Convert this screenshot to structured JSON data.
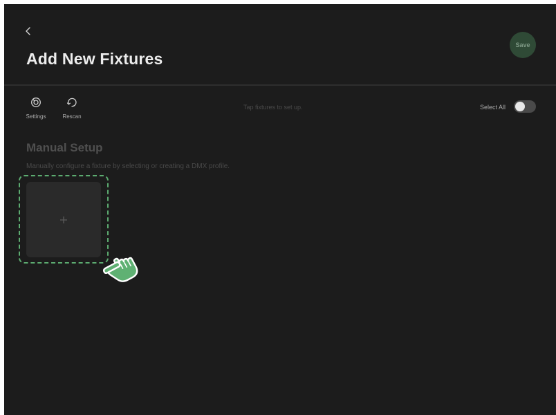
{
  "header": {
    "back_icon": "chevron-left-icon",
    "title": "Add New Fixtures",
    "save_label": "Save"
  },
  "toolbar": {
    "settings_label": "Settings",
    "settings_icon": "settings-icon",
    "rescan_label": "Rescan",
    "rescan_icon": "refresh-icon",
    "hint": "Tap fixtures to set up.",
    "select_all_label": "Select All",
    "select_all_on": false
  },
  "manual_setup": {
    "title": "Manual Setup",
    "description": "Manually configure a fixture by selecting or creating a DMX profile.",
    "add_icon": "plus-icon"
  },
  "overlay": {
    "pointer_icon": "pointing-hand-icon"
  },
  "colors": {
    "background": "#1c1c1c",
    "accent": "#5cab70",
    "save_bg": "#2f4a36"
  }
}
